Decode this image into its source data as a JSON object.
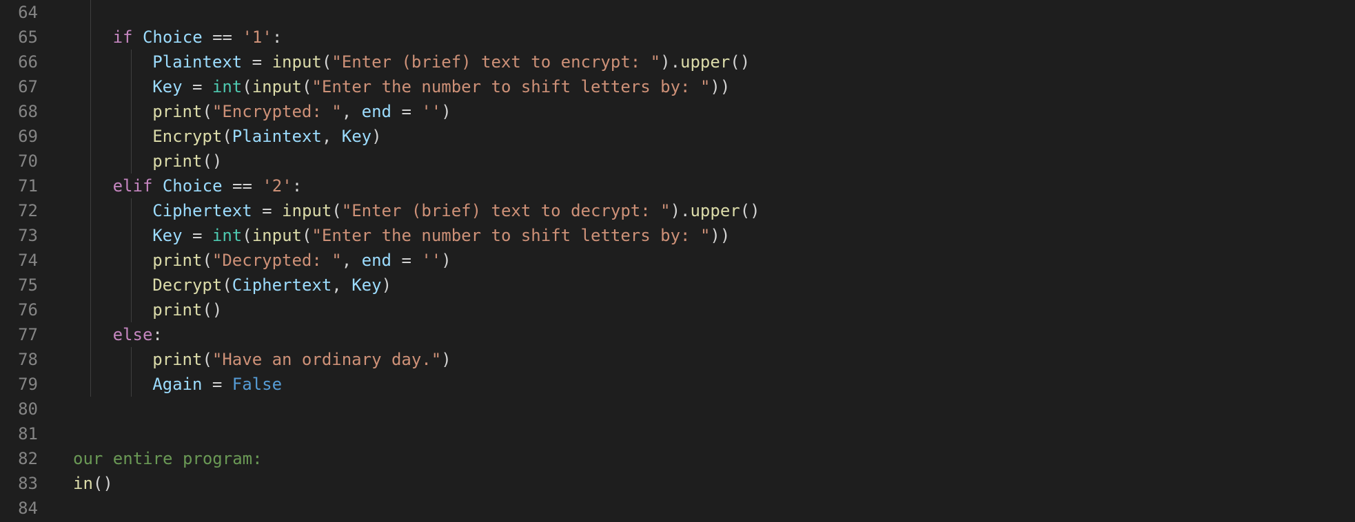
{
  "editor": {
    "colors": {
      "background": "#1e1e1e",
      "line_number": "#858585",
      "keyword": "#c586c0",
      "variable": "#9cdcfe",
      "function": "#dcdcaa",
      "string": "#ce9178",
      "type": "#4ec9b0",
      "constant": "#569cd6",
      "comment": "#6a9955",
      "plain": "#d4d4d4"
    },
    "lines": [
      {
        "num": "64",
        "indent": 0,
        "tokens": []
      },
      {
        "num": "65",
        "indent": 2,
        "tokens": [
          [
            "kw",
            "if"
          ],
          [
            "pun",
            " "
          ],
          [
            "var",
            "Choice"
          ],
          [
            "pun",
            " == "
          ],
          [
            "str",
            "'1'"
          ],
          [
            "pun",
            ":"
          ]
        ]
      },
      {
        "num": "66",
        "indent": 3,
        "tokens": [
          [
            "var",
            "Plaintext"
          ],
          [
            "pun",
            " = "
          ],
          [
            "fn",
            "input"
          ],
          [
            "pun",
            "("
          ],
          [
            "str",
            "\"Enter (brief) text to encrypt: \""
          ],
          [
            "pun",
            ")."
          ],
          [
            "fn",
            "upper"
          ],
          [
            "pun",
            "()"
          ]
        ]
      },
      {
        "num": "67",
        "indent": 3,
        "tokens": [
          [
            "var",
            "Key"
          ],
          [
            "pun",
            " = "
          ],
          [
            "type",
            "int"
          ],
          [
            "pun",
            "("
          ],
          [
            "fn",
            "input"
          ],
          [
            "pun",
            "("
          ],
          [
            "str",
            "\"Enter the number to shift letters by: \""
          ],
          [
            "pun",
            "))"
          ]
        ]
      },
      {
        "num": "68",
        "indent": 3,
        "tokens": [
          [
            "fn",
            "print"
          ],
          [
            "pun",
            "("
          ],
          [
            "str",
            "\"Encrypted: \""
          ],
          [
            "pun",
            ", "
          ],
          [
            "var",
            "end"
          ],
          [
            "pun",
            " = "
          ],
          [
            "str",
            "''"
          ],
          [
            "pun",
            ")"
          ]
        ]
      },
      {
        "num": "69",
        "indent": 3,
        "tokens": [
          [
            "fn",
            "Encrypt"
          ],
          [
            "pun",
            "("
          ],
          [
            "var",
            "Plaintext"
          ],
          [
            "pun",
            ", "
          ],
          [
            "var",
            "Key"
          ],
          [
            "pun",
            ")"
          ]
        ]
      },
      {
        "num": "70",
        "indent": 3,
        "tokens": [
          [
            "fn",
            "print"
          ],
          [
            "pun",
            "()"
          ]
        ]
      },
      {
        "num": "71",
        "indent": 2,
        "tokens": [
          [
            "kw",
            "elif"
          ],
          [
            "pun",
            " "
          ],
          [
            "var",
            "Choice"
          ],
          [
            "pun",
            " == "
          ],
          [
            "str",
            "'2'"
          ],
          [
            "pun",
            ":"
          ]
        ]
      },
      {
        "num": "72",
        "indent": 3,
        "tokens": [
          [
            "var",
            "Ciphertext"
          ],
          [
            "pun",
            " = "
          ],
          [
            "fn",
            "input"
          ],
          [
            "pun",
            "("
          ],
          [
            "str",
            "\"Enter (brief) text to decrypt: \""
          ],
          [
            "pun",
            ")."
          ],
          [
            "fn",
            "upper"
          ],
          [
            "pun",
            "()"
          ]
        ]
      },
      {
        "num": "73",
        "indent": 3,
        "tokens": [
          [
            "var",
            "Key"
          ],
          [
            "pun",
            " = "
          ],
          [
            "type",
            "int"
          ],
          [
            "pun",
            "("
          ],
          [
            "fn",
            "input"
          ],
          [
            "pun",
            "("
          ],
          [
            "str",
            "\"Enter the number to shift letters by: \""
          ],
          [
            "pun",
            "))"
          ]
        ]
      },
      {
        "num": "74",
        "indent": 3,
        "tokens": [
          [
            "fn",
            "print"
          ],
          [
            "pun",
            "("
          ],
          [
            "str",
            "\"Decrypted: \""
          ],
          [
            "pun",
            ", "
          ],
          [
            "var",
            "end"
          ],
          [
            "pun",
            " = "
          ],
          [
            "str",
            "''"
          ],
          [
            "pun",
            ")"
          ]
        ]
      },
      {
        "num": "75",
        "indent": 3,
        "tokens": [
          [
            "fn",
            "Decrypt"
          ],
          [
            "pun",
            "("
          ],
          [
            "var",
            "Ciphertext"
          ],
          [
            "pun",
            ", "
          ],
          [
            "var",
            "Key"
          ],
          [
            "pun",
            ")"
          ]
        ]
      },
      {
        "num": "76",
        "indent": 3,
        "tokens": [
          [
            "fn",
            "print"
          ],
          [
            "pun",
            "()"
          ]
        ]
      },
      {
        "num": "77",
        "indent": 2,
        "tokens": [
          [
            "kw",
            "else"
          ],
          [
            "pun",
            ":"
          ]
        ]
      },
      {
        "num": "78",
        "indent": 3,
        "tokens": [
          [
            "fn",
            "print"
          ],
          [
            "pun",
            "("
          ],
          [
            "str",
            "\"Have an ordinary day.\""
          ],
          [
            "pun",
            ")"
          ]
        ]
      },
      {
        "num": "79",
        "indent": 3,
        "tokens": [
          [
            "var",
            "Again"
          ],
          [
            "pun",
            " = "
          ],
          [
            "const",
            "False"
          ]
        ]
      },
      {
        "num": "80",
        "indent": 0,
        "tokens": []
      },
      {
        "num": "81",
        "indent": 0,
        "tokens": []
      },
      {
        "num": "82",
        "indent": 0,
        "tokens": [
          [
            "cmt",
            "our entire program:"
          ]
        ]
      },
      {
        "num": "83",
        "indent": 0,
        "tokens": [
          [
            "fn",
            "in"
          ],
          [
            "pun",
            "()"
          ]
        ]
      },
      {
        "num": "84",
        "indent": 0,
        "tokens": []
      }
    ]
  }
}
